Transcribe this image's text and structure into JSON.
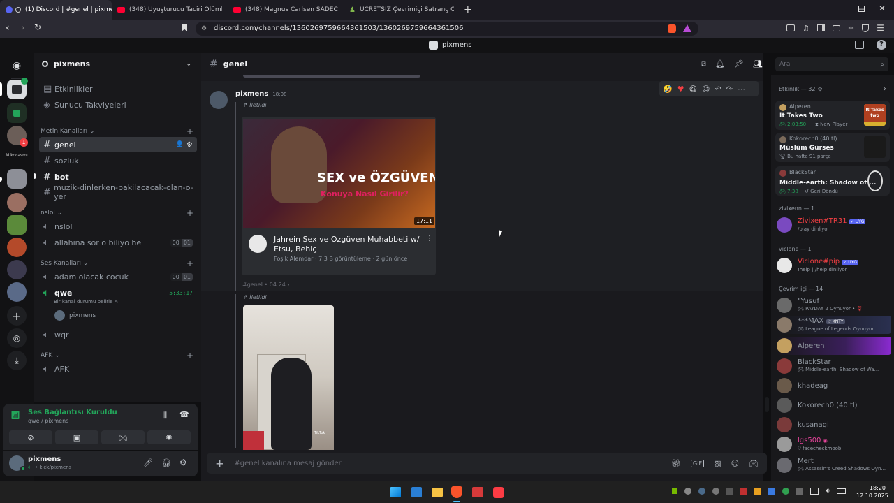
{
  "browser": {
    "tabs": [
      {
        "label": "(1) Discord | #genel | pixmens",
        "active": true
      },
      {
        "label": "(348) Uyuşturucu Taciri Ölümle Karşı",
        "active": false
      },
      {
        "label": "(348) Magnus Carlsen SADECE 15 SA",
        "active": false
      },
      {
        "label": "ÜCRETSİZ Çevrimiçi Satranç Oynayın",
        "active": false
      }
    ],
    "url": "discord.com/channels/1360269759664361503/1360269759664361506"
  },
  "discord_header": {
    "title": "pixmens"
  },
  "servers": {
    "label_mikocasm": "Mikocasmı",
    "badge": "1"
  },
  "server": {
    "name": "pixmens",
    "items": [
      {
        "label": "Etkinlikler"
      },
      {
        "label": "Sunucu Takviyeleri"
      }
    ],
    "categories": {
      "text": "Metin Kanalları",
      "nslol": "nslol",
      "voice": "Ses Kanalları",
      "afk": "AFK"
    },
    "text_channels": [
      "genel",
      "sozluk",
      "bot",
      "muzik-dinlerken-bakilacacak-olan-o-yer"
    ],
    "nslol_channels": [
      {
        "name": "nslol"
      },
      {
        "name": "allahına sor o biliyo he",
        "c1": "00",
        "c2": "01"
      }
    ],
    "voice_channels": [
      {
        "name": "adam olacak cocuk",
        "c1": "00",
        "c2": "01"
      },
      {
        "name": "qwe",
        "time": "5:33:17",
        "status": "Bir kanal durumu belirle",
        "user": "pixmens"
      },
      {
        "name": "wqr"
      }
    ],
    "afk_channels": [
      "AFK"
    ]
  },
  "voice_panel": {
    "title": "Ses Bağlantısı Kuruldu",
    "subtitle": "qwe / pixmens"
  },
  "user_panel": {
    "name": "pixmens",
    "status": "• kick/pixmens"
  },
  "chat": {
    "channel": "genel",
    "message": {
      "author": "pixmens",
      "time": "18:08",
      "forwarded": "İletildi"
    },
    "video": {
      "thumb_title": "SEX ve ÖZGÜVEN",
      "thumb_sub": "Konuya Nasıl Girilir?",
      "duration": "17:11",
      "title": "Jahrein Sex ve Özgüven Muhabbeti w/ Etsu, Behiç",
      "meta": "Foşik Alemdar · 7,3 B görüntüleme · 2 gün önce"
    },
    "source": "#genel • 04:24 ›",
    "forwarded2": "İletildi",
    "tiktok": "TikTok",
    "input_placeholder": "#genel kanalına mesaj gönder"
  },
  "search": {
    "placeholder": "Ara"
  },
  "members": {
    "activity_header": "Etkinlik — 32",
    "activities": [
      {
        "user": "Alperen",
        "game": "It Takes Two",
        "detail": "2:03:50",
        "extra": "New Player",
        "thumb": "It Takes two"
      },
      {
        "user": "Kokorech0 (40 tl)",
        "game": "Müslüm Gürses",
        "detail": "Bu hafta 91 parça"
      },
      {
        "user": "BlackStar",
        "game": "Middle-earth: Shadow of ...",
        "detail": "7:38",
        "extra": "Geri Döndü"
      }
    ],
    "groups": [
      {
        "header": "zivixenn — 1",
        "members": [
          {
            "name": "Zivixen#TR31",
            "status": "/play dinliyor",
            "tag": "UYG",
            "color": "#f23f43"
          }
        ]
      },
      {
        "header": "viclone — 1",
        "members": [
          {
            "name": "Viclone#pip",
            "status": "!help | /help dinliyor",
            "tag": "UYG",
            "color": "#f23f43"
          }
        ]
      },
      {
        "header": "Çevrim içi — 14",
        "members": [
          {
            "name": "\"Yusuf",
            "status": "PAYDAY 2 Oynuyor •",
            "color": "#949ba4"
          },
          {
            "name": "***MAX",
            "status": "League of Legends Oynuyor",
            "tag": "KNTY",
            "color": "#949ba4"
          },
          {
            "name": "Alperen",
            "status": "",
            "color": "#949ba4"
          },
          {
            "name": "BlackStar",
            "status": "Middle-earth: Shadow of Wa...",
            "color": "#949ba4"
          },
          {
            "name": "khadeag",
            "status": "",
            "color": "#949ba4"
          },
          {
            "name": "Kokorech0 (40 tl)",
            "status": "",
            "color": "#949ba4"
          },
          {
            "name": "kusanagi",
            "status": "",
            "color": "#949ba4"
          },
          {
            "name": "lgs500",
            "status": "facecheckmoob",
            "color": "#eb459e"
          },
          {
            "name": "Mert",
            "status": "Assassin's Creed Shadows Oyn...",
            "color": "#949ba4"
          }
        ]
      }
    ]
  },
  "taskbar": {
    "time": "18:20",
    "date": "12.10.2025"
  }
}
